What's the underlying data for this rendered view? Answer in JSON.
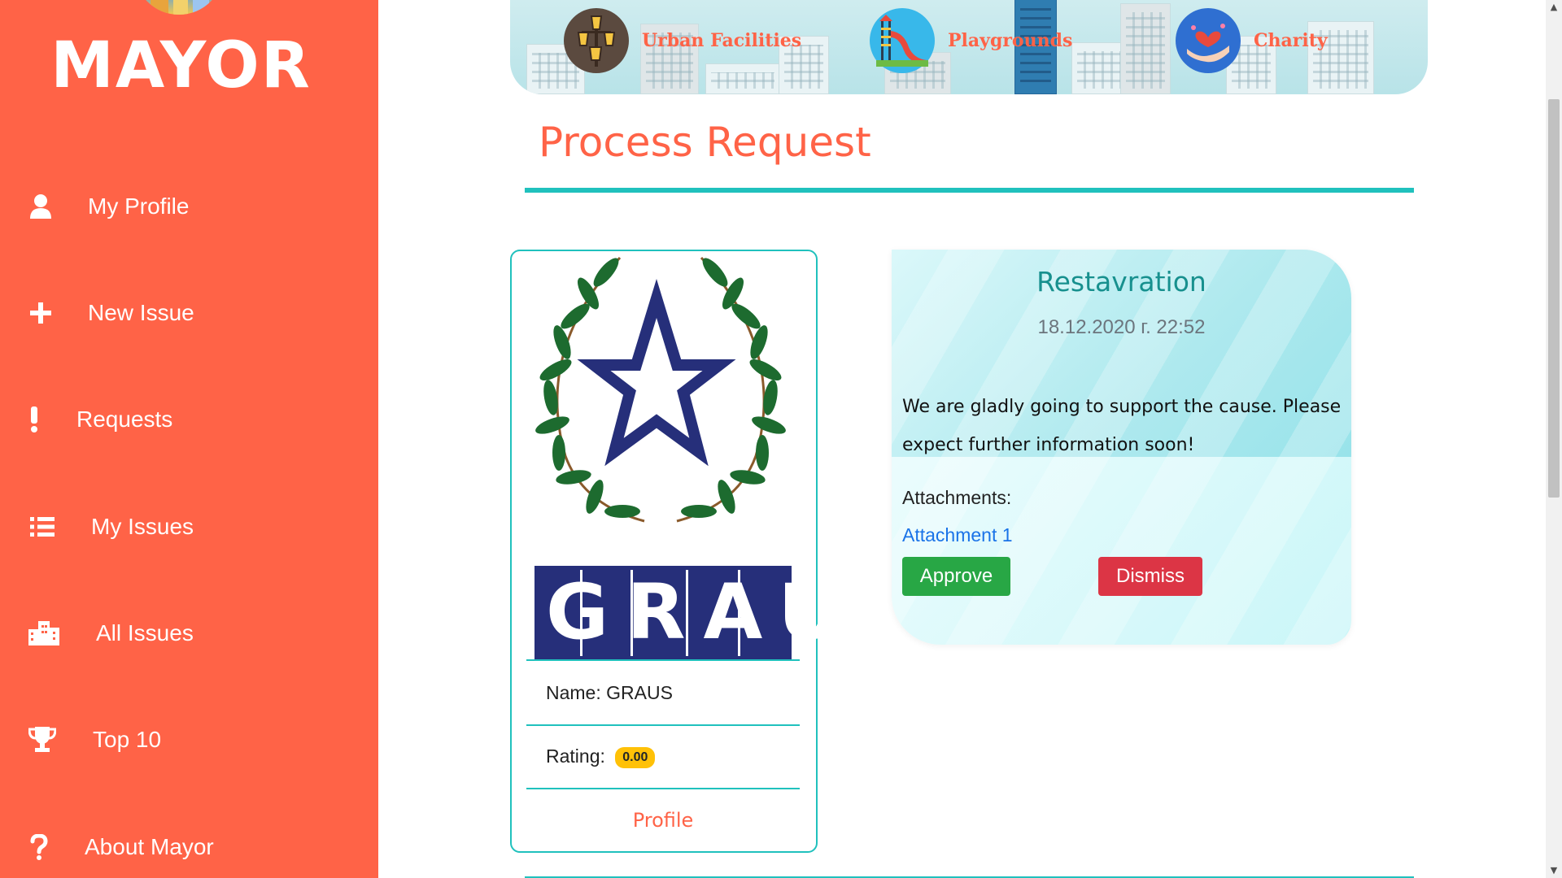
{
  "sidebar": {
    "title": "MAYOR",
    "items": [
      {
        "label": "My Profile",
        "icon": "user-icon"
      },
      {
        "label": "New Issue",
        "icon": "plus-icon"
      },
      {
        "label": "Requests",
        "icon": "exclamation-icon"
      },
      {
        "label": "My Issues",
        "icon": "list-icon"
      },
      {
        "label": "All Issues",
        "icon": "city-icon"
      },
      {
        "label": "Top 10",
        "icon": "trophy-icon"
      },
      {
        "label": "About Mayor",
        "icon": "question-icon"
      }
    ],
    "color": "#ff6347"
  },
  "banner": {
    "categories": [
      {
        "label": "Urban Facilities",
        "icon": "street-lamp-icon"
      },
      {
        "label": "Playgrounds",
        "icon": "slide-icon"
      },
      {
        "label": "Charity",
        "icon": "heart-hands-icon"
      }
    ]
  },
  "page": {
    "title": "Process Request",
    "accent": "#20c1bd"
  },
  "organization": {
    "logo_text": "GRAUS",
    "name_label": "Name:",
    "name": "GRAUS",
    "rating_label": "Rating:",
    "rating": "0.00",
    "profile_link": "Profile"
  },
  "request": {
    "title": "Restavration",
    "date": "18.12.2020 г. 22:52",
    "message": "We are gladly going to support the cause. Please expect further information soon!",
    "attachments_label": "Attachments:",
    "attachment_link": "Attachment 1",
    "approve_label": "Approve",
    "dismiss_label": "Dismiss"
  }
}
